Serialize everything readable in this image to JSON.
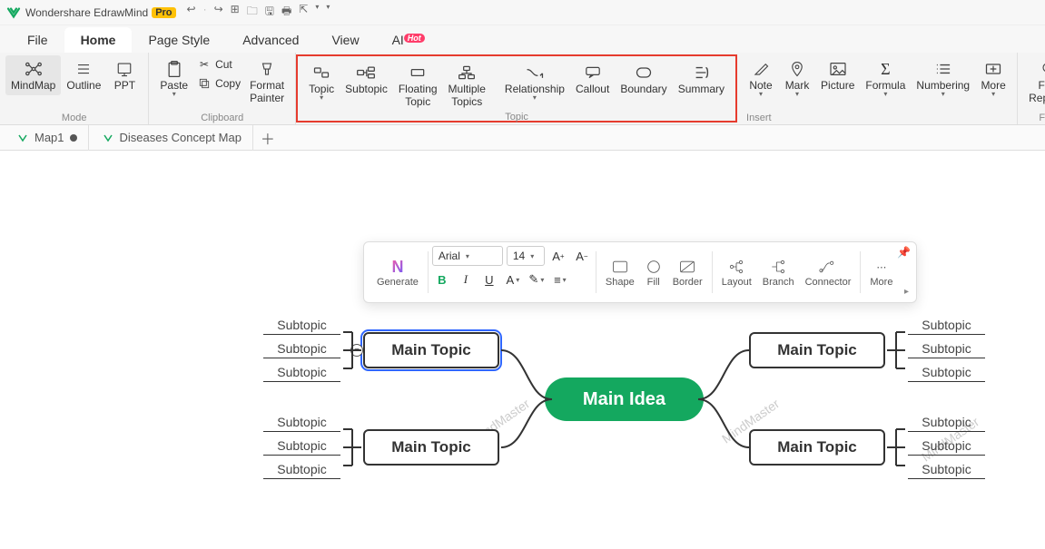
{
  "app": {
    "name": "Wondershare EdrawMind",
    "badge": "Pro"
  },
  "menu": {
    "file": "File",
    "home": "Home",
    "page_style": "Page Style",
    "advanced": "Advanced",
    "view": "View",
    "ai": "AI",
    "ai_badge": "Hot"
  },
  "ribbon": {
    "mode": {
      "label": "Mode",
      "mindmap": "MindMap",
      "outline": "Outline",
      "ppt": "PPT"
    },
    "clipboard": {
      "label": "Clipboard",
      "paste": "Paste",
      "cut": "Cut",
      "copy": "Copy",
      "painter": "Format\nPainter"
    },
    "topic": {
      "label": "Topic",
      "topic": "Topic",
      "subtopic": "Subtopic",
      "floating": "Floating\nTopic",
      "multiple": "Multiple\nTopics",
      "relationship": "Relationship",
      "callout": "Callout",
      "boundary": "Boundary",
      "summary": "Summary"
    },
    "insert": {
      "label": "Insert",
      "note": "Note",
      "mark": "Mark",
      "picture": "Picture",
      "formula": "Formula",
      "numbering": "Numbering",
      "more": "More"
    },
    "find": {
      "label": "Find",
      "find_replace": "Find\nReplace"
    }
  },
  "tabs": {
    "t1": "Map1",
    "t2": "Diseases Concept Map"
  },
  "floatbar": {
    "generate": "Generate",
    "font": "Arial",
    "size": "14",
    "shape": "Shape",
    "fill": "Fill",
    "border": "Border",
    "layout": "Layout",
    "branch": "Branch",
    "connector": "Connector",
    "more": "More"
  },
  "map": {
    "center": "Main Idea",
    "main": "Main Topic",
    "sub": "Subtopic",
    "watermark": "MindMaster"
  }
}
